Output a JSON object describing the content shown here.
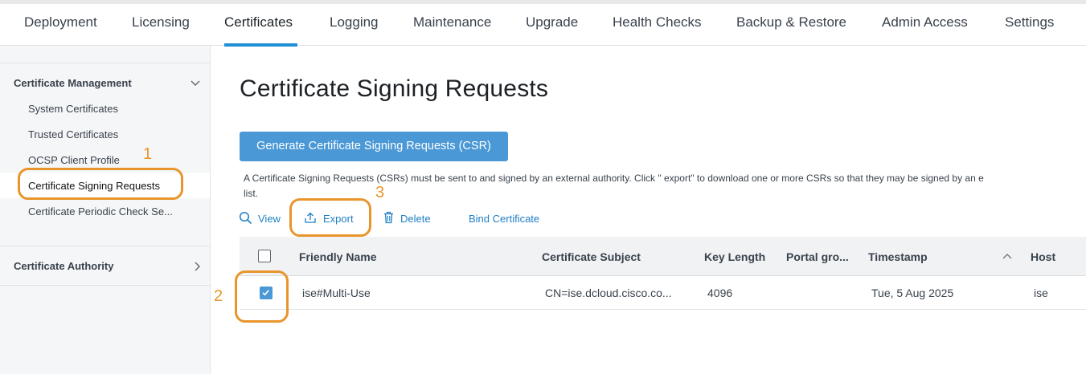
{
  "top_tabs": [
    {
      "label": "Deployment"
    },
    {
      "label": "Licensing"
    },
    {
      "label": "Certificates",
      "active": true
    },
    {
      "label": "Logging"
    },
    {
      "label": "Maintenance"
    },
    {
      "label": "Upgrade"
    },
    {
      "label": "Health Checks"
    },
    {
      "label": "Backup & Restore"
    },
    {
      "label": "Admin Access"
    },
    {
      "label": "Settings"
    }
  ],
  "sidebar": {
    "management": {
      "title": "Certificate Management",
      "items": [
        {
          "label": "System Certificates"
        },
        {
          "label": "Trusted Certificates"
        },
        {
          "label": "OCSP Client Profile"
        },
        {
          "label": "Certificate Signing Requests",
          "selected": true
        },
        {
          "label": "Certificate Periodic Check Se..."
        }
      ]
    },
    "authority": {
      "title": "Certificate Authority"
    }
  },
  "main": {
    "title": "Certificate Signing Requests",
    "generate_button": "Generate Certificate Signing Requests (CSR)",
    "description_line1": "A Certificate Signing Requests (CSRs) must be sent to and signed by an external authority. Click \" export\"  to download one or more CSRs so that they may be signed by an e",
    "description_line2": "list.",
    "toolbar": {
      "view": "View",
      "export": "Export",
      "delete": "Delete",
      "bind": "Bind Certificate"
    },
    "table": {
      "columns": [
        "Friendly Name",
        "Certificate Subject",
        "Key Length",
        "Portal gro...",
        "Timestamp",
        "Host"
      ],
      "rows": [
        {
          "checked": true,
          "friendly_name": "ise#Multi-Use",
          "subject": "CN=ise.dcloud.cisco.co...",
          "key_length": "4096",
          "portal_group": "",
          "timestamp": "Tue, 5 Aug 2025",
          "host": "ise"
        }
      ]
    }
  },
  "annotations": [
    "1",
    "2",
    "3"
  ],
  "colors": {
    "accent_blue": "#1f8fd6",
    "button_blue": "#4a98d6",
    "link_blue": "#1f7fc4",
    "annotation_orange": "#e8952c"
  }
}
